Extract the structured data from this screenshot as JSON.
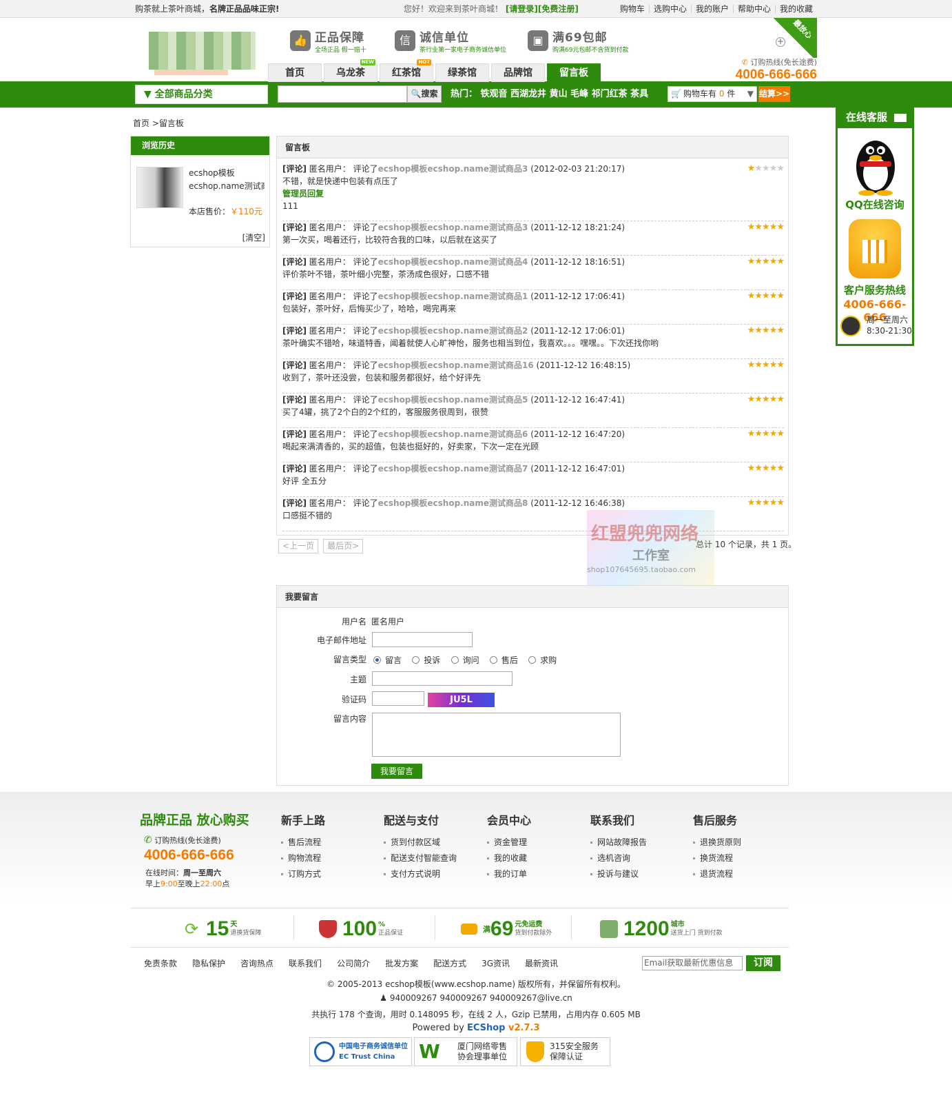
{
  "topbar": {
    "slogan_a": "购茶就上茶叶商城，",
    "slogan_b": "名牌正品品味正宗!",
    "welcome": "您好！欢迎来到茶叶商城！",
    "login": "[请登录]",
    "register": "[免费注册]",
    "links": [
      "购物车",
      "选购中心",
      "我的账户",
      "帮助中心",
      "我的收藏"
    ]
  },
  "header": {
    "guarantees": [
      {
        "icon": "thumb-icon",
        "title": "正品保障",
        "sub": "全场正品  假一赔十"
      },
      {
        "icon": "credit-icon",
        "title": "诚信单位",
        "sub": "茶行业第一家电子商务诚信单位"
      },
      {
        "icon": "truck-icon",
        "title": "满69包邮",
        "sub": "购满69元包邮不含货到付款"
      }
    ],
    "corner": "最放心",
    "hotline_label": "订购热线(免长途费)",
    "hotline_number": "4006-666-666",
    "nav": [
      {
        "label": "首页",
        "tag": ""
      },
      {
        "label": "乌龙茶",
        "tag": "NEW"
      },
      {
        "label": "红茶馆",
        "tag": "HOT"
      },
      {
        "label": "绿茶馆",
        "tag": ""
      },
      {
        "label": "品牌馆",
        "tag": ""
      },
      {
        "label": "留言板",
        "tag": ""
      }
    ]
  },
  "greenbar": {
    "category": "全部商品分类",
    "search_btn": "搜索",
    "hot": "热门：  铁观音  西湖龙井  黄山  毛峰  祁门红茶  茶具",
    "cart_text": "购物车有",
    "cart_count": "0",
    "cart_unit": "件",
    "pay": "结算>>"
  },
  "crumb": "首页  >留言板",
  "history": {
    "title": "浏览历史",
    "item_title_1": "ecshop模板",
    "item_title_2": "ecshop.name测试商",
    "price_label": "本店售价：",
    "price": "￥110元",
    "clear": "[清空]"
  },
  "board": {
    "title": "留言板",
    "messages": [
      {
        "product": "ecshop模板ecshop.name测试商品3",
        "time": "(2012-02-03 21:20:17)",
        "content": "不错，就是快递中包装有点压了",
        "reply_label": "管理员回复",
        "reply": "111",
        "stars": 1
      },
      {
        "product": "ecshop模板ecshop.name测试商品3",
        "time": "(2011-12-12 18:21:24)",
        "content": "第一次买，喝着还行，比较符合我的口味，以后就在这买了",
        "stars": 5
      },
      {
        "product": "ecshop模板ecshop.name测试商品4",
        "time": "(2011-12-12 18:16:51)",
        "content": "评价茶叶不错，茶叶细小完整，茶汤成色很好，口感不错",
        "stars": 5
      },
      {
        "product": "ecshop模板ecshop.name测试商品1",
        "time": "(2011-12-12 17:06:41)",
        "content": "包装好，茶叶好，后悔买少了，哈哈，喝完再来",
        "stars": 5
      },
      {
        "product": "ecshop模板ecshop.name测试商品2",
        "time": "(2011-12-12 17:06:01)",
        "content": "茶叶确实不错哈，味道特香，闻着就使人心旷神怡，服务也相当到位，我喜欢。。。嘿嘿。。下次还找你哟",
        "stars": 5
      },
      {
        "product": "ecshop模板ecshop.name测试商品16",
        "time": "(2011-12-12 16:48:15)",
        "content": "收到了，茶叶还没尝，包装和服务都很好，给个好评先",
        "stars": 5
      },
      {
        "product": "ecshop模板ecshop.name测试商品5",
        "time": "(2011-12-12 16:47:41)",
        "content": "买了4罐，挑了2个白的2个红的，客服服务很周到，很赞",
        "stars": 5
      },
      {
        "product": "ecshop模板ecshop.name测试商品6",
        "time": "(2011-12-12 16:47:20)",
        "content": "喝起来满清香的，买的超值，包装也挺好的，好卖家，下次一定在光顾",
        "stars": 5
      },
      {
        "product": "ecshop模板ecshop.name测试商品7",
        "time": "(2011-12-12 16:47:01)",
        "content": "好评 全五分",
        "stars": 5
      },
      {
        "product": "ecshop模板ecshop.name测试商品8",
        "time": "(2011-12-12 16:46:38)",
        "content": "口感挺不错的",
        "stars": 5
      }
    ],
    "tag": "[评论]",
    "user": " 匿名用户：  评论了",
    "prev": "<上一页",
    "last": "最后页>",
    "total": "总计 10 个记录，共 1 页。"
  },
  "watermark": {
    "a": "红盟兜兜网络",
    "b": "工作室",
    "c": "shop107645695.taobao.com"
  },
  "form": {
    "title": "我要留言",
    "user_label": "用户名",
    "user_value": "匿名用户",
    "email_label": "电子邮件地址",
    "type_label": "留言类型",
    "types": [
      "留言",
      "投诉",
      "询问",
      "售后",
      "求购"
    ],
    "subject_label": "主题",
    "captcha_label": "验证码",
    "captcha": "JU5L",
    "content_label": "留言内容",
    "submit": "我要留言"
  },
  "service": {
    "title": "在线客服",
    "qq": "QQ在线咨询",
    "hotline_title": "客户服务热线",
    "hotline": "4006-666-666",
    "days": "周一至周六",
    "hours": "8:30-21:30"
  },
  "footer": {
    "brand": "品牌正品  放心购买",
    "hot_label": "订购热线(免长途费)",
    "hot_number": "4006-666-666",
    "time1": "在线时间：",
    "time1b": "周一至周六",
    "time2a": "早上",
    "time2b": "9:00",
    "time2c": "至晚上",
    "time2d": "22:00",
    "time2e": "点",
    "cols": [
      {
        "title": "新手上路",
        "items": [
          "售后流程",
          "购物流程",
          "订购方式"
        ]
      },
      {
        "title": "配送与支付",
        "items": [
          "货到付款区域",
          "配送支付智能查询",
          "支付方式说明"
        ]
      },
      {
        "title": "会员中心",
        "items": [
          "资金管理",
          "我的收藏",
          "我的订单"
        ]
      },
      {
        "title": "联系我们",
        "items": [
          "网站故障报告",
          "选机咨询",
          "投诉与建议"
        ]
      },
      {
        "title": "售后服务",
        "items": [
          "退换货原则",
          "换货流程",
          "退货流程"
        ]
      }
    ],
    "promos": [
      {
        "big": "15",
        "sup": "天",
        "sub": "退换货保障"
      },
      {
        "big": "100",
        "sup": "%",
        "sub": "正品保证"
      },
      {
        "pre": "满",
        "big": "69",
        "sup": "元免运费",
        "sub": "货到付款除外"
      },
      {
        "big": "1200",
        "sup": "城市",
        "sub": "送货上门  货到付款"
      }
    ],
    "links": [
      "免责条款",
      "隐私保护",
      "咨询热点",
      "联系我们",
      "公司简介",
      "批发方案",
      "配送方式",
      "3G资讯",
      "最新资讯"
    ],
    "email_placeholder": "Email获取最新优惠信息",
    "subscribe": "订阅",
    "copyright": "© 2005-2013 ecshop模板(www.ecshop.name) 版权所有，并保留所有权利。",
    "contacts": "940009267  940009267  940009267@live.cn",
    "stats": "共执行 178 个查询，用时 0.148095 秒，在线 2 人，Gzip 已禁用，占用内存 0.605 MB",
    "powered_a": "Powered by ",
    "powered_b": "ECShop",
    "powered_c": " v2.7.3",
    "badges": [
      "中国电子商务诚信单位  EC Trust China",
      "厦门网络零售  协会理事单位",
      "315安全服务  保障认证"
    ]
  }
}
